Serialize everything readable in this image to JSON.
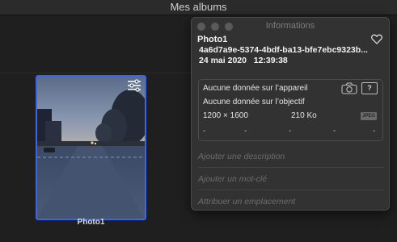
{
  "window": {
    "title": "Mes albums"
  },
  "thumbnail": {
    "label": "Photo1"
  },
  "info": {
    "title": "Informations",
    "name": "Photo1",
    "id": "4a6d7a9e-5374-4bdf-ba13-bfe7ebc9323b...",
    "date": "24 mai 2020",
    "time": "12:39:38",
    "device_line": "Aucune donnée sur l’appareil",
    "lens_line": "Aucune donnée sur l’objectif",
    "dimensions": "1200 × 1600",
    "file_size": "210 Ko",
    "format": "JPEG",
    "exif_placeholders": [
      "-",
      "-",
      "-",
      "-",
      "-"
    ],
    "help_label": "?",
    "description_placeholder": "Ajouter une description",
    "keyword_placeholder": "Ajouter un mot-clé",
    "location_placeholder": "Attribuer un emplacement"
  },
  "colors": {
    "selection": "#3f63e6",
    "panel_bg": "#323232",
    "window_bg": "#1f1f1f"
  },
  "icons": [
    "heart-icon",
    "camera-icon",
    "help-icon",
    "adjust-icon"
  ]
}
